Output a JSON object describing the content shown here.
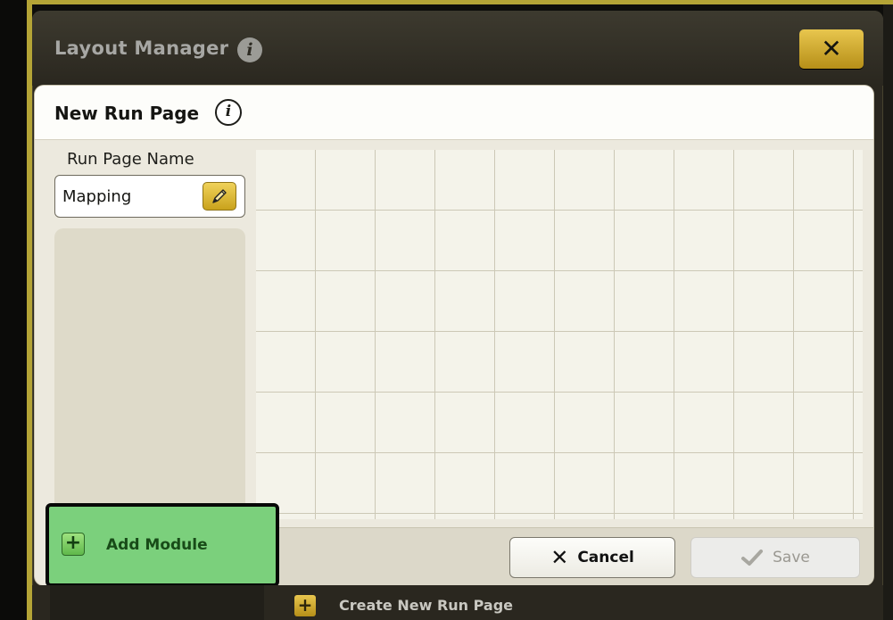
{
  "window": {
    "title": "Layout Manager"
  },
  "dialog": {
    "title": "New Run Page",
    "run_page_name_label": "Run Page Name",
    "run_page_name_value": "Mapping"
  },
  "buttons": {
    "cancel_label": "Cancel",
    "save_label": "Save",
    "add_module_label": "Add Module",
    "create_new_run_page_label": "Create New Run Page"
  },
  "icons": {
    "window_info": "info-icon",
    "dialog_info": "info-icon",
    "close": "close-icon",
    "edit": "pencil-icon",
    "cancel": "x-icon",
    "save": "checkmark-icon",
    "add": "plus-icon"
  },
  "colors": {
    "accent_yellow": "#e0bd40",
    "highlight_green": "#7bd07c",
    "panel_dark": "#2a271f"
  }
}
